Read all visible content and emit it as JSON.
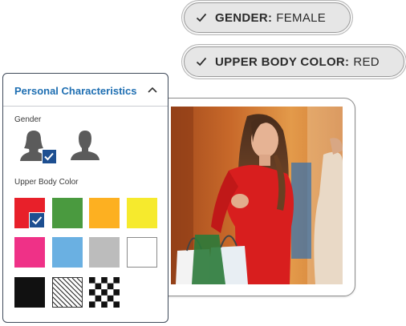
{
  "chips": [
    {
      "key": "GENDER:",
      "value": "FEMALE"
    },
    {
      "key": "UPPER BODY COLOR:",
      "value": "RED"
    }
  ],
  "panel": {
    "title": "Personal Characteristics",
    "collapse_icon": "chevron-up-icon",
    "gender_label": "Gender",
    "gender_options": [
      {
        "name": "female",
        "icon": "female-person-icon",
        "selected": true
      },
      {
        "name": "male",
        "icon": "male-person-icon",
        "selected": false
      }
    ],
    "color_label": "Upper Body Color",
    "color_swatches": [
      {
        "name": "red",
        "color": "#e8202a",
        "selected": true
      },
      {
        "name": "green",
        "color": "#4a9a3f",
        "selected": false
      },
      {
        "name": "orange",
        "color": "#fdb021",
        "selected": false
      },
      {
        "name": "yellow",
        "color": "#f6ea2d",
        "selected": false
      },
      {
        "name": "pink",
        "color": "#ef3187",
        "selected": false
      },
      {
        "name": "light-blue",
        "color": "#6ab0e2",
        "selected": false
      },
      {
        "name": "gray",
        "color": "#bcbcbc",
        "selected": false
      },
      {
        "name": "white",
        "color": "#ffffff",
        "selected": false
      },
      {
        "name": "black",
        "color": "#111111",
        "selected": false
      },
      {
        "name": "striped",
        "color": "pattern-stripes",
        "selected": false
      },
      {
        "name": "checkered",
        "color": "pattern-checker",
        "selected": false
      }
    ]
  },
  "colors": {
    "accent": "#1f6fb2",
    "check_badge": "#1d4f91"
  }
}
